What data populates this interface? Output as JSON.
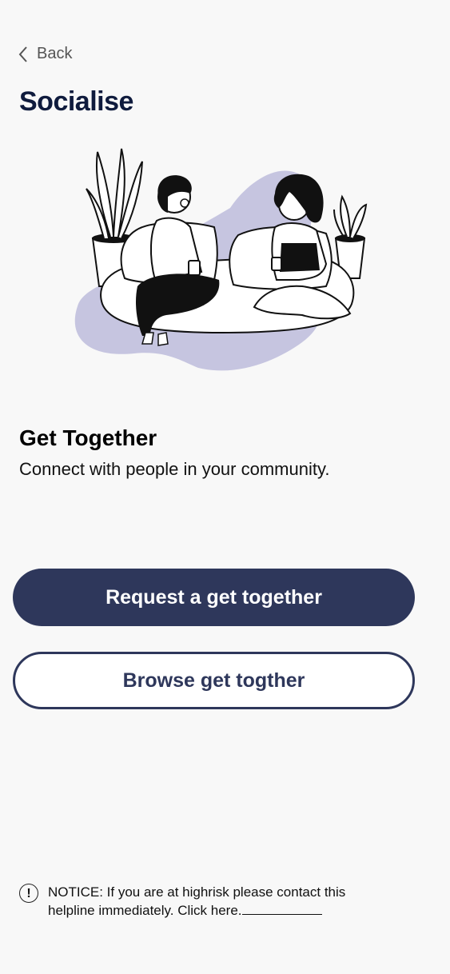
{
  "nav": {
    "back_label": "Back"
  },
  "page": {
    "title": "Socialise"
  },
  "section": {
    "title": "Get Together",
    "subtitle": "Connect with people in your community."
  },
  "buttons": {
    "request_label": "Request a get together",
    "browse_label": "Browse get togther"
  },
  "notice": {
    "text": "NOTICE: If you are at highrisk please contact this helpline immediately. Click here.",
    "icon": "!"
  },
  "colors": {
    "primary": "#2e375b",
    "title": "#0f1b3d",
    "blob": "#c6c5e0",
    "background": "#f8f8f8"
  }
}
